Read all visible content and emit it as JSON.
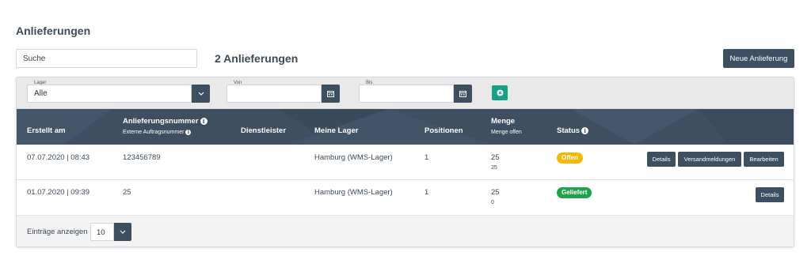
{
  "page": {
    "title": "Anlieferungen"
  },
  "toolbar": {
    "search_placeholder": "Suche",
    "count_label": "2 Anlieferungen",
    "new_button": "Neue Anlieferung"
  },
  "filters": {
    "lager": {
      "label": "Lager",
      "value": "Alle"
    },
    "von": {
      "label": "Von",
      "value": ""
    },
    "bis": {
      "label": "Bis",
      "value": ""
    }
  },
  "table": {
    "headers": {
      "erstellt": "Erstellt am",
      "anlieferungsnummer": "Anlieferungsnummer",
      "externe": "Externe Auftragsnummer",
      "dienstleister": "Dienstleister",
      "lager": "Meine Lager",
      "positionen": "Positionen",
      "menge": "Menge",
      "menge_offen": "Menge offen",
      "status": "Status"
    },
    "rows": [
      {
        "erstellt": "07.07.2020 | 08:43",
        "nummer": "123456789",
        "dienstleister": "",
        "lager": "Hamburg (WMS-Lager)",
        "positionen": "1",
        "menge": "25",
        "menge_offen": "25",
        "status": "Offen",
        "actions": [
          "Details",
          "Versandmeldungen",
          "Bearbeiten"
        ]
      },
      {
        "erstellt": "01.07.2020 | 09:39",
        "nummer": "25",
        "dienstleister": "",
        "lager": "Hamburg (WMS-Lager)",
        "positionen": "1",
        "menge": "25",
        "menge_offen": "0",
        "status": "Geliefert",
        "actions": [
          "Details"
        ]
      }
    ]
  },
  "footer": {
    "label": "Einträge anzeigen",
    "page_size": "10"
  },
  "colors": {
    "primary": "#3d4f61",
    "teal": "#16a085",
    "status_offen": "#f6b800",
    "status_geliefert": "#1fa24a"
  }
}
